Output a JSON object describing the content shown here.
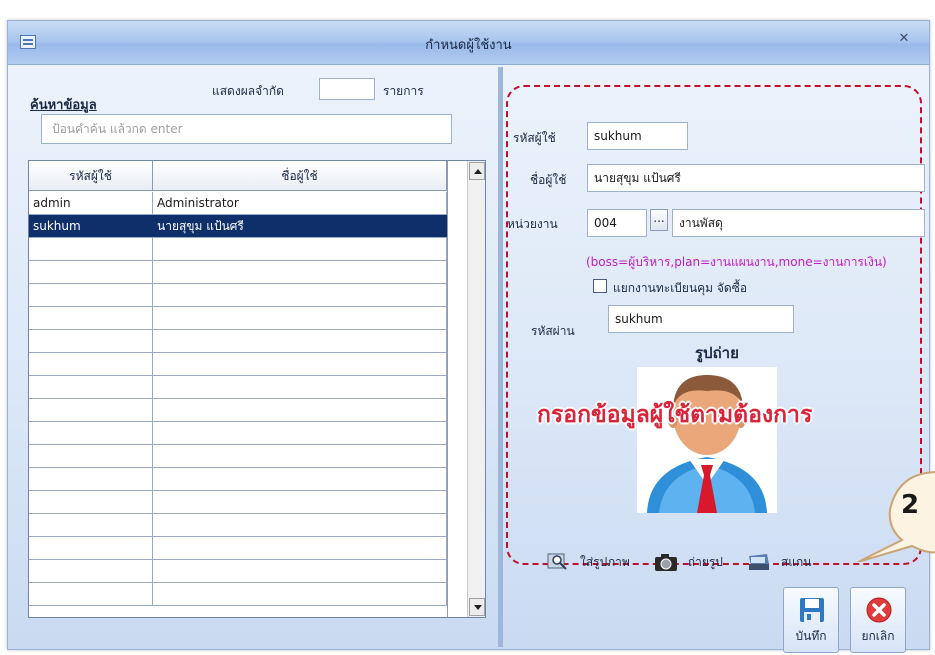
{
  "window": {
    "title": "กำหนดผู้ใช้งาน",
    "close_glyph": "✕"
  },
  "search": {
    "label": "ค้นหาข้อมูล",
    "limit_label": "แสดงผลจำกัด",
    "limit_value": "",
    "items_label": "รายการ",
    "placeholder": "ป้อนคำค้น แล้วกด enter"
  },
  "grid": {
    "columns": [
      "รหัสผู้ใช้",
      "ชื่อผู้ใช้"
    ],
    "rows": [
      {
        "code": "admin",
        "name": "Administrator",
        "selected": false
      },
      {
        "code": "sukhum",
        "name": "นายสุขุม  แป้นศรี",
        "selected": true
      },
      {
        "code": "",
        "name": "",
        "selected": false
      },
      {
        "code": "",
        "name": "",
        "selected": false
      },
      {
        "code": "",
        "name": "",
        "selected": false
      },
      {
        "code": "",
        "name": "",
        "selected": false
      },
      {
        "code": "",
        "name": "",
        "selected": false
      },
      {
        "code": "",
        "name": "",
        "selected": false
      },
      {
        "code": "",
        "name": "",
        "selected": false
      },
      {
        "code": "",
        "name": "",
        "selected": false
      },
      {
        "code": "",
        "name": "",
        "selected": false
      },
      {
        "code": "",
        "name": "",
        "selected": false
      },
      {
        "code": "",
        "name": "",
        "selected": false
      },
      {
        "code": "",
        "name": "",
        "selected": false
      },
      {
        "code": "",
        "name": "",
        "selected": false
      },
      {
        "code": "",
        "name": "",
        "selected": false
      },
      {
        "code": "",
        "name": "",
        "selected": false
      },
      {
        "code": "",
        "name": "",
        "selected": false
      }
    ]
  },
  "form": {
    "user_code_label": "รหัสผู้ใช้",
    "user_code": "sukhum",
    "user_name_label": "ชื่อผู้ใช้",
    "user_name": "นายสุขุม  แป้นศรี",
    "unit_label": "หน่วยงาน",
    "unit_code": "004",
    "unit_browse": "...",
    "unit_name": "งานพัสดุ",
    "hint": "(boss=ผู้บริหาร,plan=งานแผนงาน,mone=งานการเงิน)",
    "separate_label": "แยกงานทะเบียนคุม จัดซื้อ",
    "password_label": "รหัสผ่าน",
    "password": "sukhum",
    "photo_title": "รูปถ่าย",
    "overlay": "กรอกข้อมูลผู้ใช้ตามต้องการ",
    "add_picture": "ใส่รูปภาพ",
    "take_photo": "ถ่ายรูป",
    "scan": "สแกน"
  },
  "buttons": {
    "save": "บันทึก",
    "cancel": "ยกเลิก"
  },
  "callout": {
    "number": "2"
  },
  "colors": {
    "selected_row": "#0f2f6a",
    "dash_frame": "#c0102c",
    "hint_text": "#c21ec4",
    "overlay_text": "#d8253a",
    "cancel_red": "#e23b3b"
  }
}
